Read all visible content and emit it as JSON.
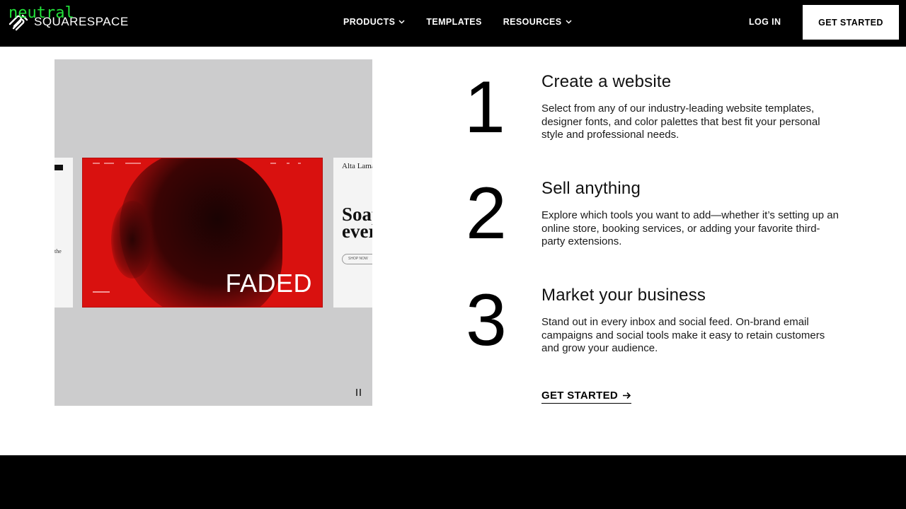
{
  "overlay": {
    "tag": "neutral"
  },
  "nav": {
    "logo_text": "SQUARESPACE",
    "items": [
      {
        "label": "PRODUCTS",
        "has_dropdown": true
      },
      {
        "label": "TEMPLATES",
        "has_dropdown": false
      },
      {
        "label": "RESOURCES",
        "has_dropdown": true
      }
    ],
    "login_label": "LOG IN",
    "cta_label": "GET STARTED"
  },
  "media": {
    "left_slide_text": "the",
    "hero_title": "FADED",
    "right_slide_small": "Alta Lama",
    "right_slide_big_line1": "Soap",
    "right_slide_big_line2": "ever",
    "right_slide_button": "SHOP NOW"
  },
  "steps": [
    {
      "number": "1",
      "title": "Create a website",
      "description": "Select from any of our industry-leading website templates, designer fonts, and color palettes that best fit your personal style and professional needs."
    },
    {
      "number": "2",
      "title": "Sell anything",
      "description": "Explore which tools you want to add—whether it’s setting up an online store, booking services, or adding your favorite third-party extensions."
    },
    {
      "number": "3",
      "title": "Market your business",
      "description": "Stand out in every inbox and social feed. On-brand email campaigns and social tools make it easy to retain customers and grow your audience."
    }
  ],
  "cta_link": {
    "label": "GET STARTED",
    "icon": "arrow-right-icon"
  },
  "colors": {
    "nav_bg": "#000000",
    "hero_red": "#d9110f",
    "media_bg": "#cccccd",
    "overlay_green": "#22e03a"
  }
}
